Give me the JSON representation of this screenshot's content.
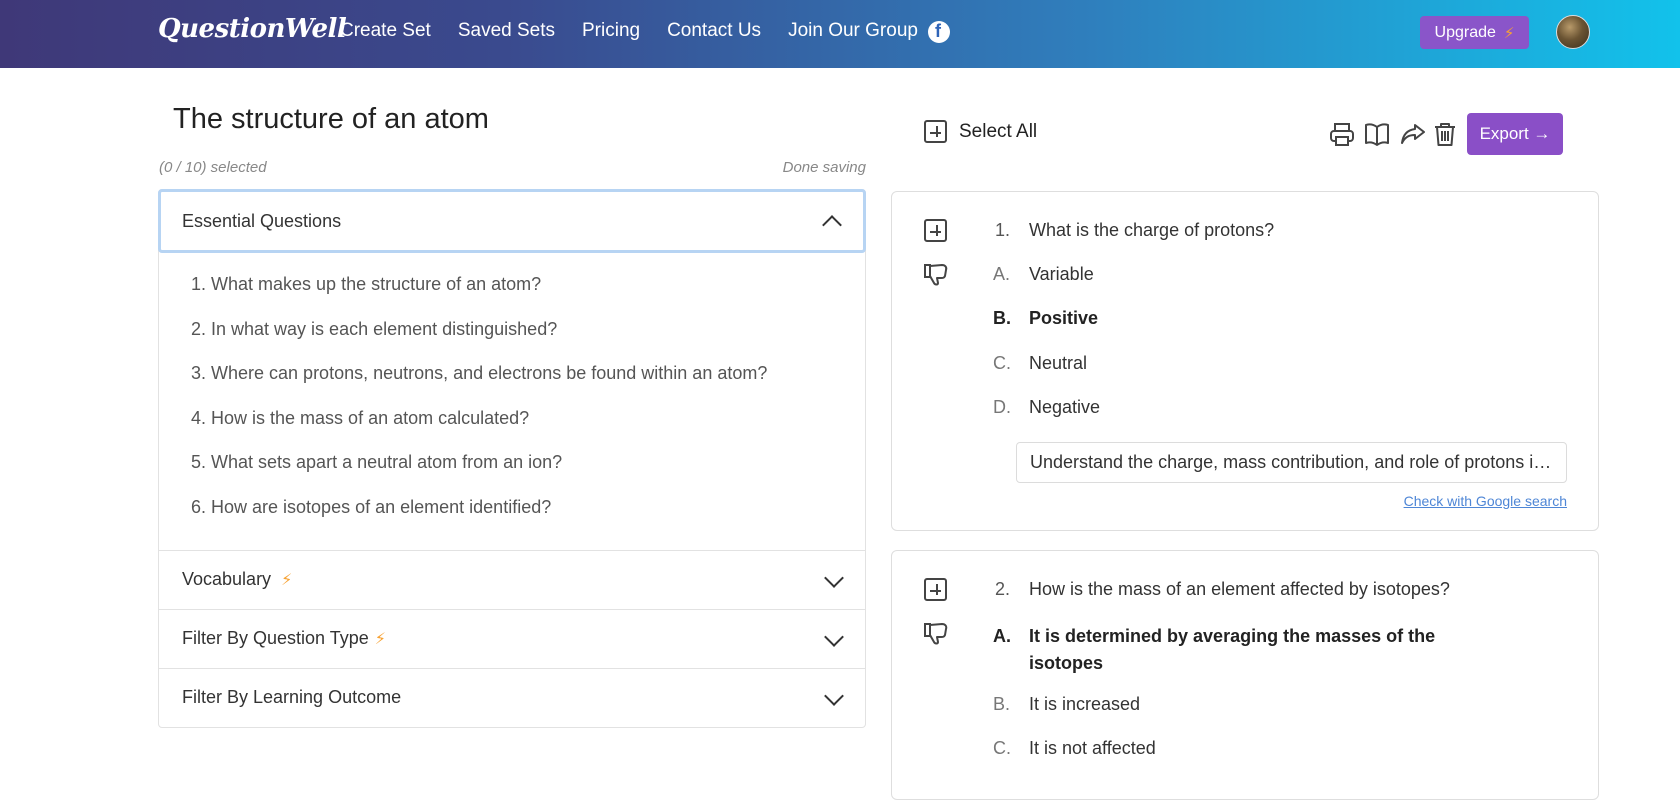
{
  "app": {
    "logo": "QuestionWell",
    "nav": [
      "Create Set",
      "Saved Sets",
      "Pricing",
      "Contact Us",
      "Join Our Group"
    ],
    "upgrade_label": "Upgrade",
    "upgrade_icon": "lightning-bolt-icon",
    "social_icon": "facebook-icon",
    "colors": {
      "accent_purple": "#8a4fc7",
      "bolt_orange": "#f7a233",
      "link_blue": "#4e86d6"
    }
  },
  "set": {
    "title": "The structure of an atom",
    "selected_count": "(0 / 10) selected",
    "save_status": "Done saving"
  },
  "sidebar": {
    "essential": {
      "label": "Essential Questions",
      "items": [
        "1. What makes up the structure of an atom?",
        "2. In what way is each element distinguished?",
        "3. Where can protons, neutrons, and electrons be found within an atom?",
        "4. How is the mass of an atom calculated?",
        "5. What sets apart a neutral atom from an ion?",
        "6. How are isotopes of an element identified?"
      ]
    },
    "vocabulary": "Vocabulary",
    "filter_type": "Filter By Question Type",
    "filter_outcome": "Filter By Learning Outcome"
  },
  "toolbar": {
    "select_all": "Select All",
    "export_label": "Export →",
    "icons": [
      "print-icon",
      "book-icon",
      "share-icon",
      "trash-icon"
    ]
  },
  "questions": [
    {
      "number": "1.",
      "text": "What is the charge of protons?",
      "options": [
        {
          "letter": "A.",
          "text": "Variable",
          "correct": false
        },
        {
          "letter": "B.",
          "text": "Positive",
          "correct": true
        },
        {
          "letter": "C.",
          "text": "Neutral",
          "correct": false
        },
        {
          "letter": "D.",
          "text": "Negative",
          "correct": false
        }
      ],
      "outcome": "Understand the charge, mass contribution, and role of protons in an atom.",
      "google_link": "Check with Google search"
    },
    {
      "number": "2.",
      "text": "How is the mass of an element affected by isotopes?",
      "options": [
        {
          "letter": "A.",
          "text": "It is determined by averaging the masses of the isotopes",
          "correct": true
        },
        {
          "letter": "B.",
          "text": "It is increased",
          "correct": false
        },
        {
          "letter": "C.",
          "text": "It is not affected",
          "correct": false
        }
      ]
    }
  ]
}
